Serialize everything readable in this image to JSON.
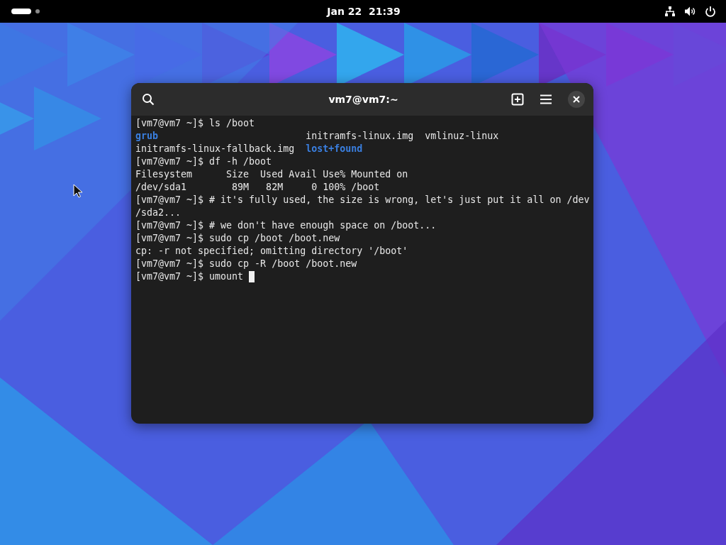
{
  "top_bar": {
    "clock": "Jan 22  21:39"
  },
  "terminal": {
    "title": "vm7@vm7:~",
    "lines": [
      {
        "segments": [
          {
            "text": "[vm7@vm7 ~]$ ls /boot",
            "kind": "plain"
          }
        ]
      },
      {
        "segments": [
          {
            "text": "grub",
            "kind": "dir"
          },
          {
            "text": "                          initramfs-linux.img  vmlinuz-linux",
            "kind": "plain"
          }
        ]
      },
      {
        "segments": [
          {
            "text": "initramfs-linux-fallback.img  ",
            "kind": "plain"
          },
          {
            "text": "lost+found",
            "kind": "dir"
          }
        ]
      },
      {
        "segments": [
          {
            "text": "[vm7@vm7 ~]$ df -h /boot",
            "kind": "plain"
          }
        ]
      },
      {
        "segments": [
          {
            "text": "Filesystem      Size  Used Avail Use% Mounted on",
            "kind": "plain"
          }
        ]
      },
      {
        "segments": [
          {
            "text": "/dev/sda1        89M   82M     0 100% /boot",
            "kind": "plain"
          }
        ]
      },
      {
        "segments": [
          {
            "text": "[vm7@vm7 ~]$ # it's fully used, the size is wrong, let's just put it all on /dev",
            "kind": "plain"
          }
        ]
      },
      {
        "segments": [
          {
            "text": "/sda2...",
            "kind": "plain"
          }
        ]
      },
      {
        "segments": [
          {
            "text": "[vm7@vm7 ~]$ # we don't have enough space on /boot...",
            "kind": "plain"
          }
        ]
      },
      {
        "segments": [
          {
            "text": "[vm7@vm7 ~]$ sudo cp /boot /boot.new",
            "kind": "plain"
          }
        ]
      },
      {
        "segments": [
          {
            "text": "cp: -r not specified; omitting directory '/boot'",
            "kind": "plain"
          }
        ]
      },
      {
        "segments": [
          {
            "text": "[vm7@vm7 ~]$ sudo cp -R /boot /boot.new",
            "kind": "plain"
          }
        ]
      },
      {
        "segments": [
          {
            "text": "[vm7@vm7 ~]$ umount ",
            "kind": "plain"
          }
        ],
        "cursor": true
      }
    ]
  }
}
